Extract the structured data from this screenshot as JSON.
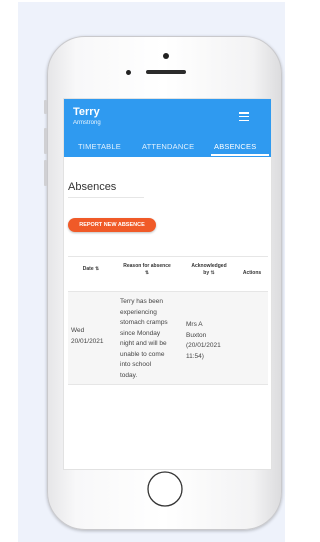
{
  "app": {
    "user_name": "Terry",
    "user_surname": "Armstrong",
    "menu_icon": "hamburger-icon"
  },
  "tabs": [
    {
      "label": "TIMETABLE",
      "active": false
    },
    {
      "label": "ATTENDANCE",
      "active": false
    },
    {
      "label": "ABSENCES",
      "active": true
    }
  ],
  "page": {
    "title": "Absences",
    "report_button": "REPORT NEW ABSENCE"
  },
  "table": {
    "headers": {
      "date": "Date",
      "date_sort": "⇅",
      "reason_line1": "Reason for absence",
      "reason_sort": "⇅",
      "ack_line1": "Acknowledged",
      "ack_line2": "by",
      "ack_sort": "⇅",
      "actions": "Actions"
    },
    "rows": [
      {
        "date_line1": "Wed",
        "date_line2": "20/01/2021",
        "reason": [
          "Terry has been",
          "experiencing",
          "stomach cramps",
          "since Monday",
          "night and will be",
          "unable to come",
          "into school",
          "today."
        ],
        "ack": [
          "Mrs A",
          "Buxton",
          "(20/01/2021",
          "11:54)"
        ],
        "actions": ""
      }
    ]
  },
  "colors": {
    "header_blue": "#2f9af0",
    "report_orange": "#f05a28"
  }
}
